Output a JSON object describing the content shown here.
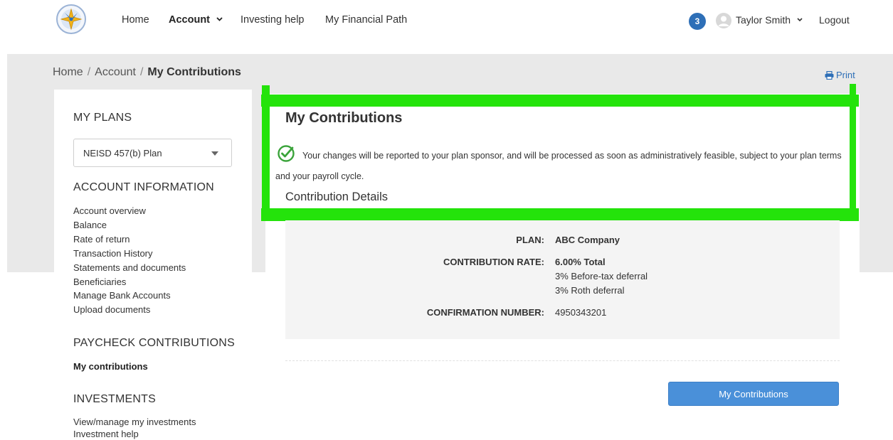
{
  "nav": {
    "home": "Home",
    "account": "Account",
    "investing_help": "Investing help",
    "financial_path": "My Financial Path",
    "notifications_count": "3",
    "user_name": "Taylor Smith",
    "logout": "Logout",
    "logo_icon": "north-east-compass-logo"
  },
  "breadcrumb": {
    "home": "Home",
    "sep": "/",
    "account": "Account",
    "current": "My Contributions"
  },
  "print": "Print",
  "sidebar": {
    "my_plans_heading": "MY PLANS",
    "plan_selected": "NEISD 457(b) Plan",
    "account_info_heading": "ACCOUNT INFORMATION",
    "account_links": [
      "Account overview",
      "Balance",
      "Rate of return",
      "Transaction History",
      "Statements and documents",
      "Beneficiaries",
      "Manage Bank Accounts",
      "Upload documents"
    ],
    "paycheck_heading": "PAYCHECK CONTRIBUTIONS",
    "paycheck_current": "My contributions",
    "investments_heading": "INVESTMENTS",
    "investment_links": [
      "View/manage my investments",
      "Investment help"
    ]
  },
  "main": {
    "title": "My Contributions",
    "message": "Your changes will be reported to your plan sponsor, and will be processed as soon as administratively feasible, subject to your plan terms and your payroll cycle.",
    "section_title": "Contribution Details",
    "plan_label": "PLAN:",
    "plan_value": "ABC Company",
    "rate_label": "CONTRIBUTION RATE:",
    "rate_total": "6.00% Total",
    "rate_line1": "3% Before-tax deferral",
    "rate_line2": "3% Roth deferral",
    "confirmation_label": "CONFIRMATION NUMBER:",
    "confirmation_value": "4950343201",
    "button_label": "My Contributions"
  },
  "colors": {
    "highlight": "#24e30b",
    "brand_blue": "#2e6fb7",
    "button_blue": "#4a90d9",
    "success_green": "#3aa33a"
  }
}
